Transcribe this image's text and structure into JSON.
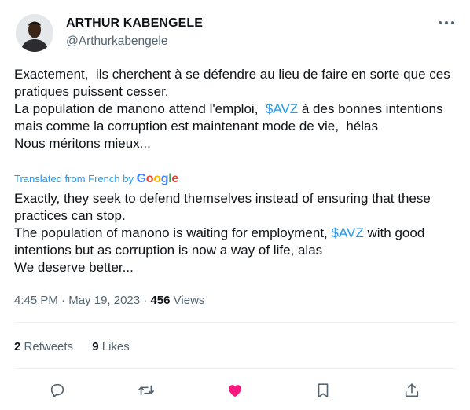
{
  "author": {
    "display_name": "ARTHUR KABENGELE",
    "handle": "@Arthurkabengele"
  },
  "original_text": {
    "para1": "Exactement,  ils cherchent à se défendre au lieu de faire en sorte que ces pratiques puissent cesser.",
    "para2_before": "La population de manono attend l'emploi,  ",
    "para2_cashtag": "$AVZ",
    "para2_after": " à des bonnes intentions mais comme la corruption est maintenant mode de vie,  hélas",
    "para3": "Nous méritons mieux..."
  },
  "translation_label": "Translated from French by",
  "translation_provider": [
    "G",
    "o",
    "o",
    "g",
    "l",
    "e"
  ],
  "translated_text": {
    "para1": "Exactly, they seek to defend themselves instead of ensuring that these practices can stop.",
    "para2_before": "The population of manono is waiting for employment, ",
    "para2_cashtag": "$AVZ",
    "para2_after": " with good intentions but as corruption is now a way of life, alas",
    "para3": "We deserve better..."
  },
  "meta": {
    "time": "4:45 PM",
    "date": "May 19, 2023",
    "views_count": "456",
    "views_label": "Views"
  },
  "stats": {
    "retweets_count": "2",
    "retweets_label": "Retweets",
    "likes_count": "9",
    "likes_label": "Likes"
  },
  "icons": {
    "more": "more-horizontal-icon",
    "reply": "reply-icon",
    "retweet": "retweet-icon",
    "like": "heart-filled-icon",
    "bookmark": "bookmark-icon",
    "share": "share-icon"
  },
  "colors": {
    "accent": "#1d9bf0",
    "like": "#f91880",
    "secondary_text": "#536471",
    "primary_text": "#0f1419"
  }
}
